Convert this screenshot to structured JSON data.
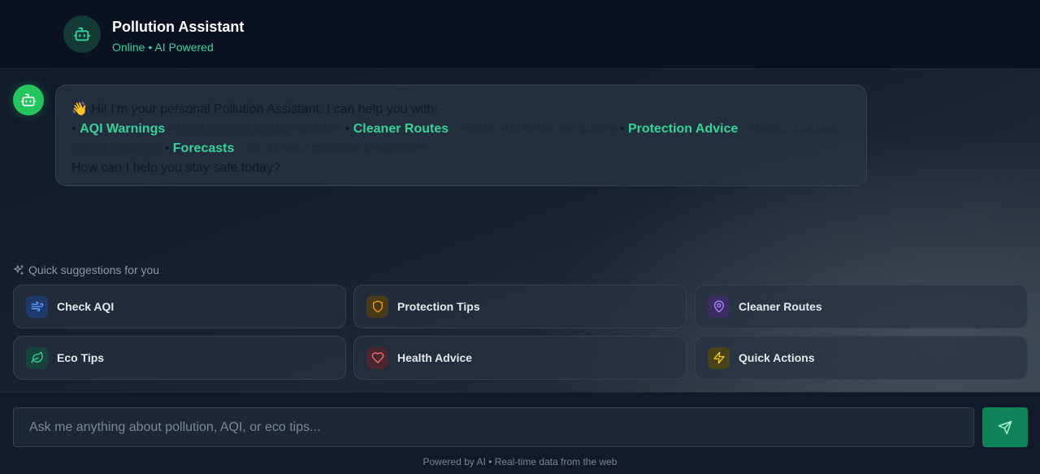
{
  "header": {
    "title": "Pollution Assistant",
    "status": "Online • AI Powered"
  },
  "message": {
    "greeting": "👋 Hi! I'm your personal Pollution Assistant. I can help you with:",
    "bullet": "•",
    "items": [
      {
        "title": "AQI Warnings",
        "desc": " - Real-time air quality updates "
      },
      {
        "title": "Cleaner Routes",
        "desc": " - Paths with better air quality "
      },
      {
        "title": "Protection Advice",
        "desc": " - Masks, timings, indoor activities "
      },
      {
        "title": "Forecasts",
        "desc": " - 12-24 hour pollution predictions"
      }
    ],
    "closing": "How can I help you stay safe today?"
  },
  "suggestions": {
    "label": "Quick suggestions for you",
    "items": [
      {
        "label": "Check AQI",
        "icon": "wind-icon",
        "color": "#60a5fa",
        "bg": "#1e3a6a"
      },
      {
        "label": "Protection Tips",
        "icon": "shield-icon",
        "color": "#f59e0b",
        "bg": "#4a3a17"
      },
      {
        "label": "Cleaner Routes",
        "icon": "map-pin-icon",
        "color": "#a78bfa",
        "bg": "#3b2d63"
      },
      {
        "label": "Eco Tips",
        "icon": "leaf-icon",
        "color": "#34d399",
        "bg": "#16433a"
      },
      {
        "label": "Health Advice",
        "icon": "heart-icon",
        "color": "#f87171",
        "bg": "#4a2630"
      },
      {
        "label": "Quick Actions",
        "icon": "zap-icon",
        "color": "#facc15",
        "bg": "#4a4218"
      }
    ]
  },
  "input": {
    "placeholder": "Ask me anything about pollution, AQI, or eco tips..."
  },
  "footer": {
    "powered": "Powered by AI • Real-time data from the web"
  }
}
